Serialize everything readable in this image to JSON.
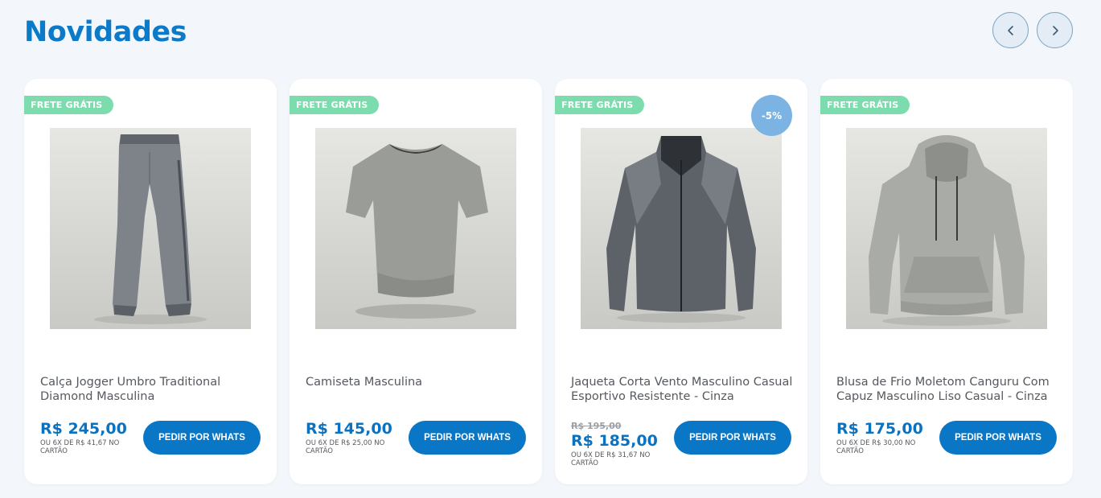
{
  "section": {
    "title": "Novidades",
    "prev_icon": "chevron-left-icon",
    "next_icon": "chevron-right-icon"
  },
  "colors": {
    "title": "#0a7ac9",
    "badge_frete": "#7ddcae",
    "badge_discount": "#7bb3e2",
    "button": "#0a76c6",
    "price": "#0a72c0"
  },
  "products": [
    {
      "badge": "FRETE GRÁTIS",
      "discount": "",
      "image": "gray-jogger-pants",
      "name": "Calça Jogger Umbro Traditional Diamond Masculina",
      "old_price": "",
      "price": "R$ 245,00",
      "installment": "OU 6X DE R$ 41,67 NO CARTÃO",
      "button": "PEDIR POR WHATS"
    },
    {
      "badge": "FRETE GRÁTIS",
      "discount": "",
      "image": "gray-t-shirt",
      "name": "Camiseta Masculina",
      "old_price": "",
      "price": "R$ 145,00",
      "installment": "OU 6X DE R$ 25,00 NO CARTÃO",
      "button": "PEDIR POR WHATS"
    },
    {
      "badge": "FRETE GRÁTIS",
      "discount": "-5%",
      "image": "gray-windbreaker-jacket",
      "name": "Jaqueta Corta Vento Masculino Casual Esportivo Resistente - Cinza",
      "old_price": "R$ 195,00",
      "price": "R$ 185,00",
      "installment": "OU 6X DE R$ 31,67 NO CARTÃO",
      "button": "PEDIR POR WHATS"
    },
    {
      "badge": "FRETE GRÁTIS",
      "discount": "",
      "image": "gray-hoodie",
      "name": "Blusa de Frio Moletom Canguru Com Capuz Masculino Liso Casual - Cinza",
      "old_price": "",
      "price": "R$ 175,00",
      "installment": "OU 6X DE R$ 30,00 NO CARTÃO",
      "button": "PEDIR POR WHATS"
    }
  ]
}
